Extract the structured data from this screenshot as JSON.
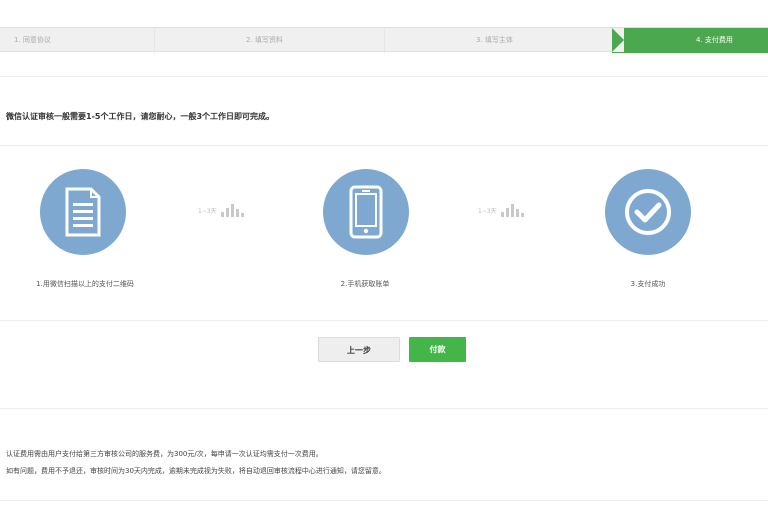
{
  "steps": [
    {
      "label": "1. 同意协议"
    },
    {
      "label": "2. 填写资料"
    },
    {
      "label": "3. 填写主体"
    },
    {
      "label": "4. 支付费用",
      "active": true
    }
  ],
  "intro": "微信认证审核一般需要1-5个工作日，请您耐心，一般3个工作日即可完成。",
  "process": [
    {
      "icon": "document-icon",
      "caption": "1.用微信扫描以上的支付二维码"
    },
    {
      "icon": "phone-icon",
      "caption": "2.手机获取账单"
    },
    {
      "icon": "check-icon",
      "caption": "3.支付成功"
    }
  ],
  "arrows": [
    {
      "label": "1~3天"
    },
    {
      "label": "1~3天"
    }
  ],
  "buttons": {
    "prev": "上一步",
    "pay": "付款"
  },
  "notes": [
    "认证费用需由用户支付给第三方审核公司的服务费，为300元/次，每申请一次认证均需支付一次费用。",
    "如有问题，费用不予退还，审核时间为30天内完成，逾期未完成视为失败，将自动退回审核流程中心进行通知，请您留意。"
  ],
  "colors": {
    "accent": "#44b549",
    "circle": "#7ea8cf",
    "stepActive": "#4ca84f"
  }
}
